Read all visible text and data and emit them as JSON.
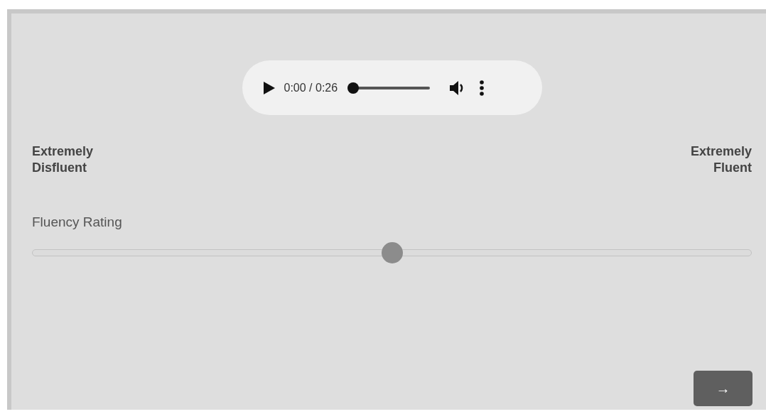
{
  "audio_player": {
    "time": "0:00 / 0:26",
    "level": 0
  },
  "scale": {
    "left_label": "Extremely Disfluent",
    "right_label": "Extremely Fluent"
  },
  "slider": {
    "label": "Fluency Rating",
    "level": 0.5
  },
  "next_button": {
    "label": "→"
  }
}
